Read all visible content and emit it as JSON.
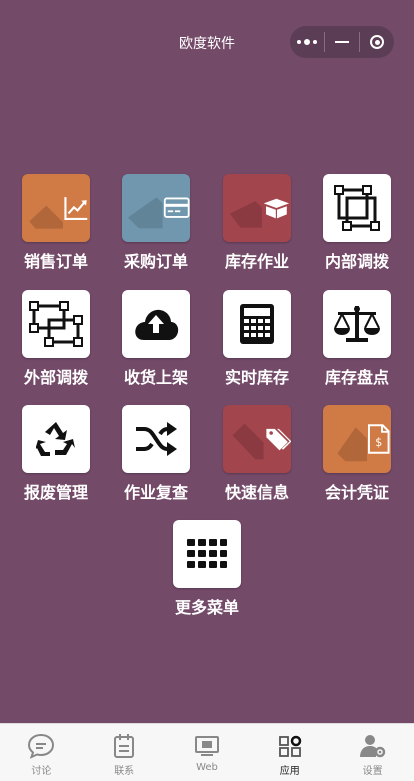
{
  "header": {
    "title": "欧度软件"
  },
  "apps": [
    {
      "label": "销售订单",
      "icon": "sales-chart-icon",
      "bg": "#d07a45"
    },
    {
      "label": "采购订单",
      "icon": "credit-card-icon",
      "bg": "#7097ad"
    },
    {
      "label": "库存作业",
      "icon": "open-box-icon",
      "bg": "#a3454c"
    },
    {
      "label": "内部调拨",
      "icon": "internal-transfer-icon",
      "bg": "#ffffff"
    },
    {
      "label": "外部调拨",
      "icon": "external-transfer-icon",
      "bg": "#ffffff"
    },
    {
      "label": "收货上架",
      "icon": "cloud-upload-icon",
      "bg": "#ffffff"
    },
    {
      "label": "实时库存",
      "icon": "calculator-icon",
      "bg": "#ffffff"
    },
    {
      "label": "库存盘点",
      "icon": "scale-icon",
      "bg": "#ffffff"
    },
    {
      "label": "报废管理",
      "icon": "recycle-icon",
      "bg": "#ffffff"
    },
    {
      "label": "作业复查",
      "icon": "shuffle-icon",
      "bg": "#ffffff"
    },
    {
      "label": "快速信息",
      "icon": "tags-icon",
      "bg": "#a3454c"
    },
    {
      "label": "会计凭证",
      "icon": "invoice-dollar-icon",
      "bg": "#d07a45"
    },
    {
      "label": "更多菜单",
      "icon": "grid-menu-icon",
      "bg": "#ffffff"
    }
  ],
  "tabs": [
    {
      "label": "讨论",
      "icon": "chat-icon",
      "active": false
    },
    {
      "label": "联系",
      "icon": "calendar-contacts-icon",
      "active": false
    },
    {
      "label": "Web",
      "icon": "web-monitor-icon",
      "active": false
    },
    {
      "label": "应用",
      "icon": "apps-grid-icon",
      "active": true
    },
    {
      "label": "设置",
      "icon": "user-settings-icon",
      "active": false
    }
  ]
}
